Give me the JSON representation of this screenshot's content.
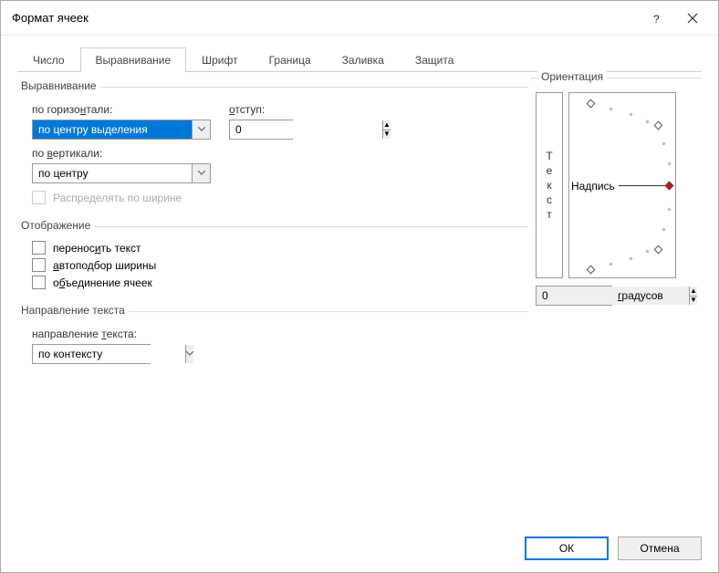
{
  "window": {
    "title": "Формат ячеек"
  },
  "tabs": {
    "number": "Число",
    "alignment": "Выравнивание",
    "font": "Шрифт",
    "border": "Граница",
    "fill": "Заливка",
    "protection": "Защита"
  },
  "align": {
    "group": "Выравнивание",
    "horizontal_label_pre": "по горизо",
    "horizontal_label_u": "н",
    "horizontal_label_post": "тали:",
    "horizontal_value": "по центру выделения",
    "indent_label_pre": "",
    "indent_label_u": "о",
    "indent_label_post": "тступ:",
    "indent_value": "0",
    "vertical_label_pre": "по ",
    "vertical_label_u": "в",
    "vertical_label_post": "ертикали:",
    "vertical_value": "по центру",
    "justify_label": "Распределять по ширине"
  },
  "display": {
    "group": "Отображение",
    "wrap_pre": "перенос",
    "wrap_u": "и",
    "wrap_post": "ть текст",
    "autofit_pre": "",
    "autofit_u": "а",
    "autofit_post": "втоподбор ширины",
    "merge_pre": "о",
    "merge_u": "б",
    "merge_post": "ъединение ячеек"
  },
  "direction": {
    "group": "Направление текста",
    "label_pre": "направление ",
    "label_u": "т",
    "label_post": "екста:",
    "value": "по контексту"
  },
  "orientation": {
    "group": "Ориентация",
    "vtext": [
      "Т",
      "е",
      "к",
      "с",
      "т"
    ],
    "label": "Надпись",
    "degrees_value": "0",
    "degrees_label_pre": "",
    "degrees_label_u": "г",
    "degrees_label_post": "радусов"
  },
  "buttons": {
    "ok": "ОК",
    "cancel": "Отмена"
  }
}
